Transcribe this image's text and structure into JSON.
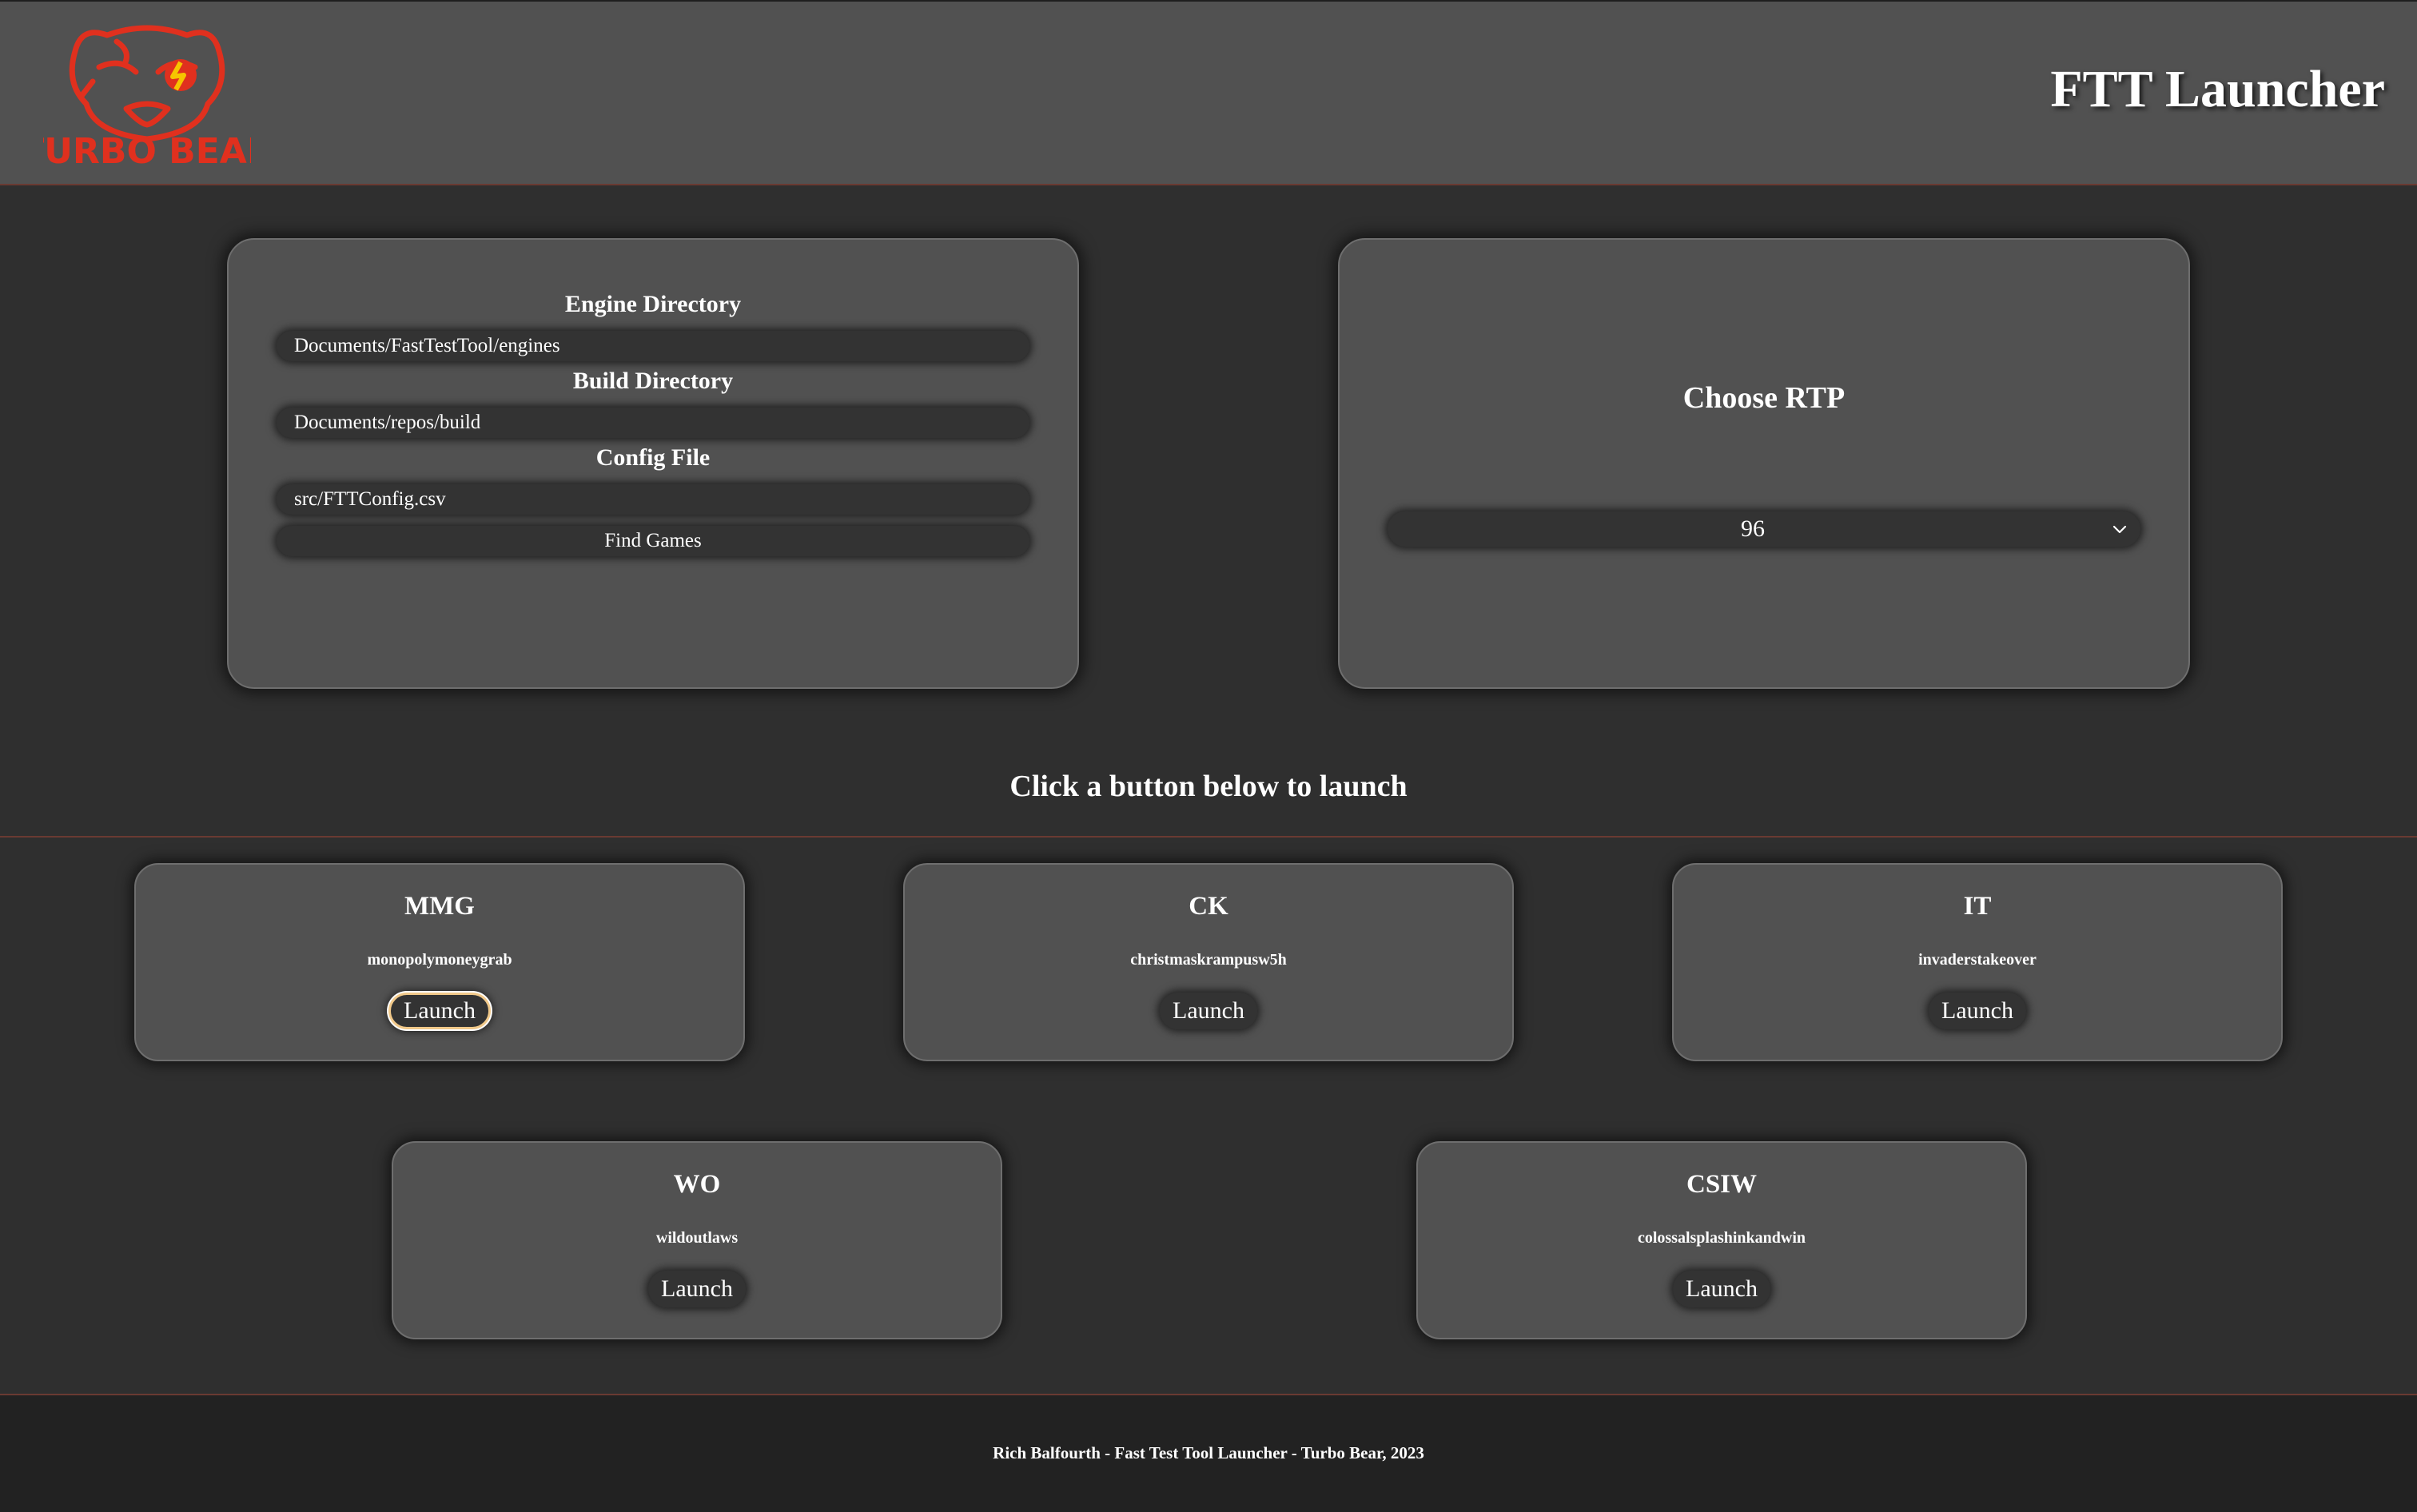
{
  "header": {
    "logo_text": "TURBO BEAR",
    "title": "FTT Launcher"
  },
  "directories": {
    "engine_label": "Engine Directory",
    "engine_value": "Documents/FastTestTool/engines",
    "build_label": "Build Directory",
    "build_value": "Documents/repos/build",
    "config_label": "Config File",
    "config_value": "src/FTTConfig.csv",
    "find_button": "Find Games"
  },
  "rtp": {
    "title": "Choose RTP",
    "selected": "96"
  },
  "instruction": "Click a button below to launch",
  "games": [
    {
      "code": "MMG",
      "name": "monopolymoneygrab",
      "launch": "Launch"
    },
    {
      "code": "CK",
      "name": "christmaskrampusw5h",
      "launch": "Launch"
    },
    {
      "code": "IT",
      "name": "invaderstakeover",
      "launch": "Launch"
    },
    {
      "code": "WO",
      "name": "wildoutlaws",
      "launch": "Launch"
    },
    {
      "code": "CSIW",
      "name": "colossalsplashinkandwin",
      "launch": "Launch"
    }
  ],
  "footer": "Rich Balfourth - Fast Test Tool Launcher - Turbo Bear, 2023",
  "colors": {
    "header_bg": "#515151",
    "page_bg": "#2f2f2f",
    "card_bg": "#515151",
    "input_bg": "#333333",
    "footer_bg": "#222222",
    "brand_red": "#e0301e",
    "focus_ring": "#f1c98a"
  }
}
